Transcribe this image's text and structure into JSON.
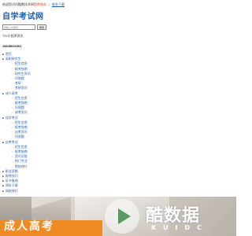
{
  "topbar": {
    "welcome": "欢迎您访问酷数技术网",
    "brand": "酷数服务",
    "link": "联系下载"
  },
  "logo": "自学考试网",
  "search": {
    "placeholder": "请输入关键词",
    "button": "搜索"
  },
  "hot": "TGI小程序资讯",
  "phone": "15645631001",
  "nav": [
    {
      "label": "首页",
      "children": []
    },
    {
      "label": "高职研究生",
      "children": [
        "招生信息",
        "报考指南",
        "研究生资讯",
        "问答题",
        "考研",
        "考研资讯"
      ]
    },
    {
      "label": "成人高考",
      "children": [
        "招生信息",
        "报考指南",
        "问答题",
        "成考资讯"
      ]
    },
    {
      "label": "自学考试",
      "children": [
        "招生信息",
        "报考指南",
        "自考资讯",
        "问答题"
      ]
    },
    {
      "label": "自考考试",
      "children": [
        "招生信息",
        "报考指南",
        "资讯问答",
        "热门专业",
        "院校排行"
      ]
    },
    {
      "label": "职业资格",
      "children": []
    },
    {
      "label": "报考技巧",
      "children": []
    },
    {
      "label": "证书查询",
      "children": []
    },
    {
      "label": "资料下载",
      "children": []
    },
    {
      "label": "网校排行",
      "children": []
    }
  ],
  "banner": {
    "text": "成人高考"
  },
  "watermark": {
    "main": "酷数据",
    "sub": "KUIDC"
  },
  "colors": {
    "link": "#1a5fb4",
    "accent": "#e05a1e",
    "banner_orange": "#f08a24"
  },
  "icons": {
    "play": "play-icon"
  }
}
